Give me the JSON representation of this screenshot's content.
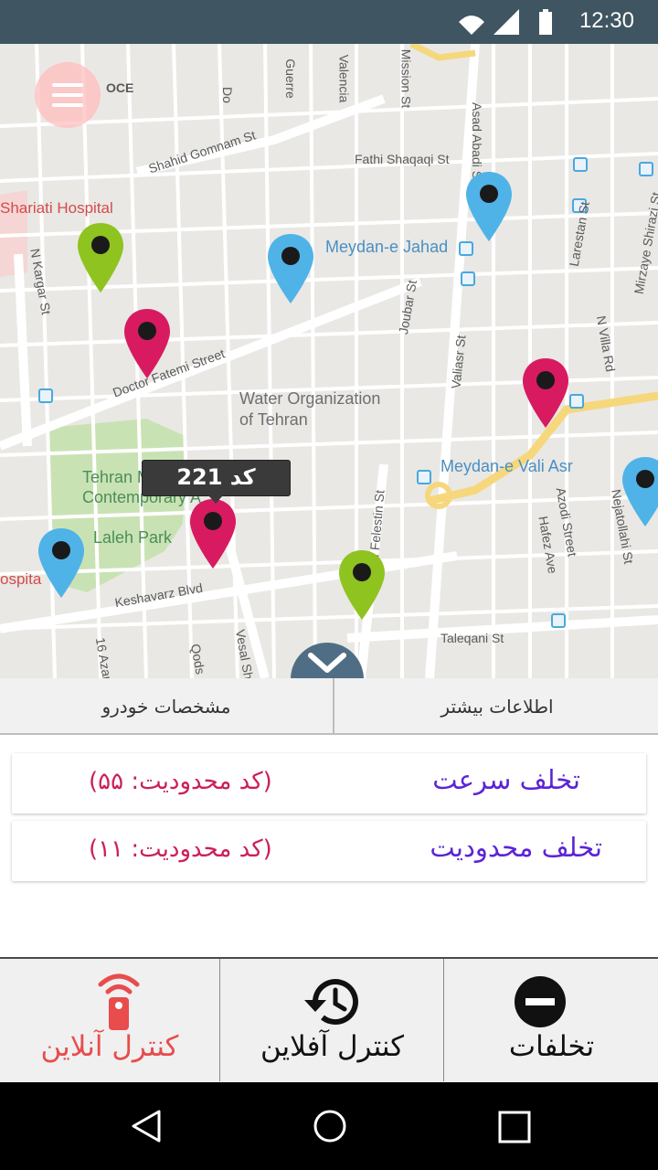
{
  "status_bar": {
    "time": "12:30",
    "icons": [
      "wifi-icon",
      "signal-icon",
      "battery-icon"
    ]
  },
  "map": {
    "street_labels": [
      "Shahid Gomnam St",
      "Fathi Shaqaqi St",
      "Doctor Fatemi Street",
      "Keshavarz Blvd",
      "Taleqani St",
      "N Kargar St",
      "Joubar St",
      "Valiasr St",
      "N Felestin St",
      "Larestan St",
      "Mirzaye Shirazi St",
      "N Villa Rd",
      "Azodi Street",
      "Hafez Ave",
      "Nejatollahi St",
      "Vesal Sh",
      "Qods",
      "16 Azar",
      "Guerre",
      "Valencia",
      "Mission St",
      "Do",
      "Asad Abadi St"
    ],
    "poi_labels": {
      "shariati_hospital": "Shariati Hospital",
      "meydan_jahad": "Meydan-e Jahad",
      "water_org_1": "Water Organization",
      "water_org_2": "of Tehran",
      "museum_1": "Tehran Mu",
      "museum_2": "Contemporary A",
      "laleh_park": "Laleh Park",
      "meydan_vali_asr": "Meydan-e Vali Asr",
      "hospital_left": "ospita",
      "doce": "OCE"
    },
    "markers": [
      {
        "color": "#8fc31f",
        "type": "green"
      },
      {
        "color": "#d81b60",
        "type": "magenta"
      },
      {
        "color": "#4fb3e8",
        "type": "blue"
      },
      {
        "color": "#4fb3e8",
        "type": "blue"
      },
      {
        "color": "#d81b60",
        "type": "magenta"
      },
      {
        "color": "#d81b60",
        "type": "magenta",
        "selected": true
      },
      {
        "color": "#4fb3e8",
        "type": "blue"
      },
      {
        "color": "#8fc31f",
        "type": "green"
      },
      {
        "color": "#4fb3e8",
        "type": "blue"
      }
    ],
    "tooltip": "کد 221"
  },
  "tabs": {
    "vehicle_specs": "مشخصات خودرو",
    "more_info": "اطلاعات بیشتر"
  },
  "violations": [
    {
      "title": "تخلف سرعت",
      "code": "(کد محدودیت: ۵۵)"
    },
    {
      "title": "تخلف محدودیت",
      "code": "(کد محدودیت:   ۱۱)"
    }
  ],
  "actions": {
    "online_control": "کنترل آنلاین",
    "offline_control": "کنترل آفلاین",
    "violations": "تخلفات"
  },
  "colors": {
    "status_bar": "#3f5561",
    "violation_title": "#5b24d6",
    "violation_code": "#cc1f5a",
    "online_control": "#e84c4c"
  }
}
